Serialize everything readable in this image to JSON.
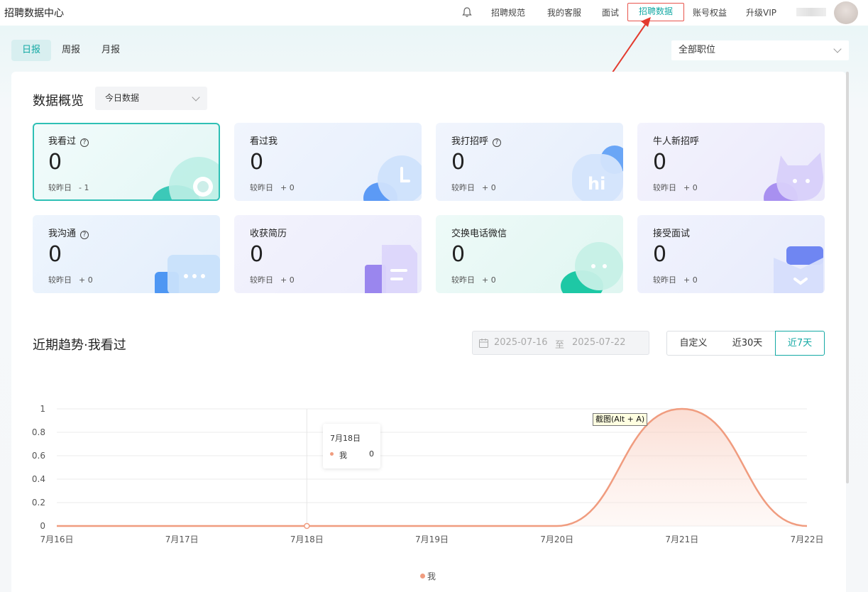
{
  "app": {
    "title": "招聘数据中心"
  },
  "nav": {
    "items": [
      "招聘规范",
      "我的客服",
      "面试",
      "招聘数据",
      "账号权益",
      "升级VIP"
    ],
    "active": "招聘数据"
  },
  "period_tabs": [
    "日报",
    "周报",
    "月报"
  ],
  "period_active": "日报",
  "job_filter": {
    "value": "全部职位"
  },
  "overview": {
    "title": "数据概览",
    "range": "今日数据",
    "compare_label": "较昨日",
    "stats": [
      {
        "label": "我看过",
        "help": true,
        "value": "0",
        "delta": "- 1",
        "highlight": true
      },
      {
        "label": "看过我",
        "help": false,
        "value": "0",
        "delta": "+ 0"
      },
      {
        "label": "我打招呼",
        "help": true,
        "value": "0",
        "delta": "+ 0"
      },
      {
        "label": "牛人新招呼",
        "help": false,
        "value": "0",
        "delta": "+ 0"
      },
      {
        "label": "我沟通",
        "help": true,
        "value": "0",
        "delta": "+ 0"
      },
      {
        "label": "收获简历",
        "help": false,
        "value": "0",
        "delta": "+ 0"
      },
      {
        "label": "交换电话微信",
        "help": false,
        "value": "0",
        "delta": "+ 0"
      },
      {
        "label": "接受面试",
        "help": false,
        "value": "0",
        "delta": "+ 0"
      }
    ]
  },
  "trend": {
    "title": "近期趋势·我看过",
    "date_start": "2025-07-16",
    "date_sep": "至",
    "date_end": "2025-07-22",
    "ranges": [
      "自定义",
      "近30天",
      "近7天"
    ],
    "range_active": "近7天"
  },
  "tooltip": {
    "date": "7月18日",
    "series": "我",
    "value": "0"
  },
  "screenshot_hint": "截图(Alt + A)",
  "colors": {
    "accent": "#14a9a4",
    "series": "#f09c7f",
    "highlight_border": "#e8554d"
  },
  "chart_data": {
    "type": "area",
    "categories": [
      "7月16日",
      "7月17日",
      "7月18日",
      "7月19日",
      "7月20日",
      "7月21日",
      "7月22日"
    ],
    "series": [
      {
        "name": "我",
        "values": [
          0,
          0,
          0,
          0,
          0,
          1,
          0
        ]
      }
    ],
    "y_ticks": [
      "0",
      "0.2",
      "0.4",
      "0.6",
      "0.8",
      "1"
    ],
    "ylim": [
      0,
      1
    ],
    "grid": true,
    "legend": "bottom"
  }
}
